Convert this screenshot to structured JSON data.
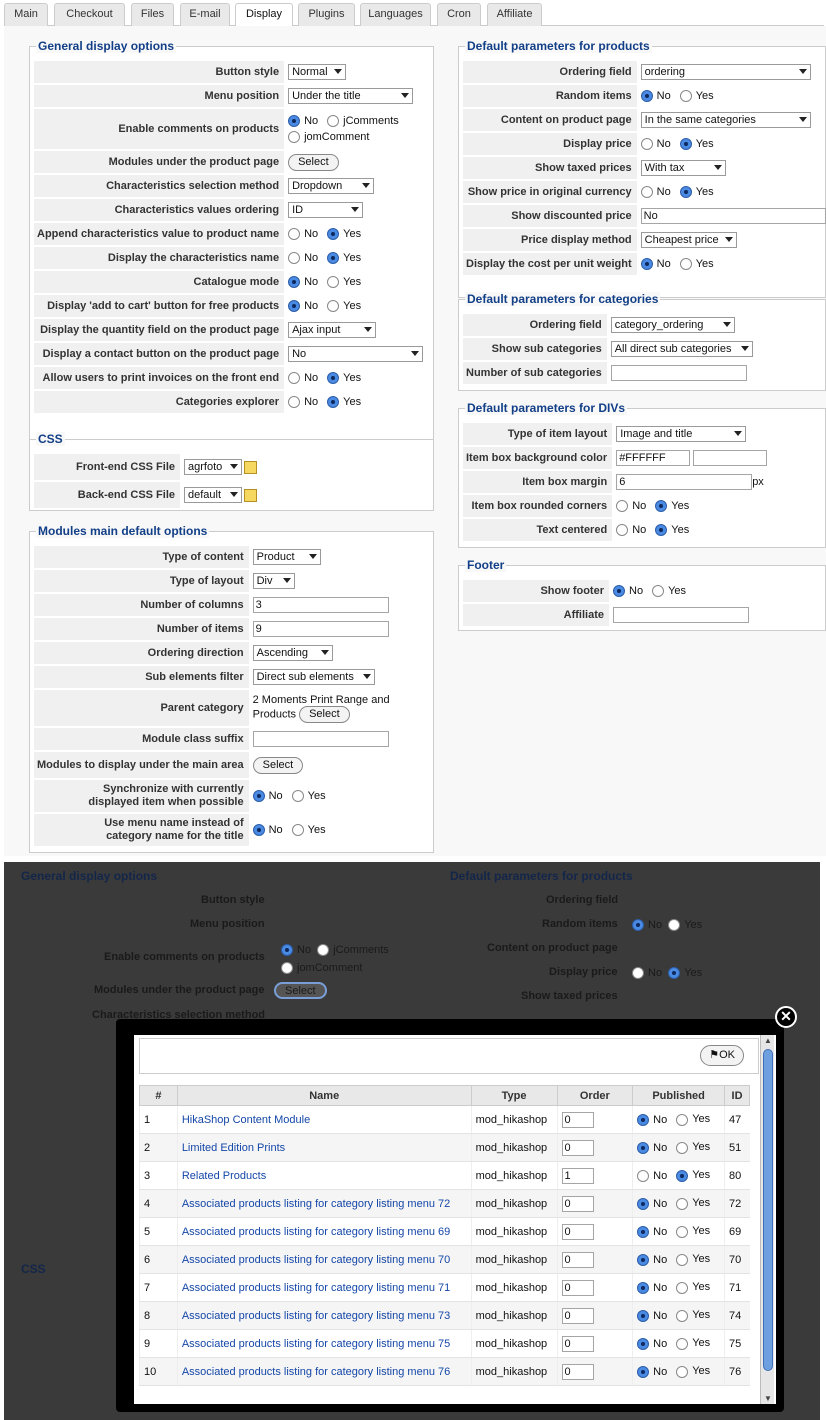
{
  "tabs": [
    {
      "label": "Main"
    },
    {
      "label": "Checkout"
    },
    {
      "label": "Files"
    },
    {
      "label": "E-mail"
    },
    {
      "label": "Display"
    },
    {
      "label": "Plugins"
    },
    {
      "label": "Languages"
    },
    {
      "label": "Cron"
    },
    {
      "label": "Affiliate"
    }
  ],
  "legends": {
    "general": "General display options",
    "css": "CSS",
    "modules": "Modules main default options",
    "products": "Default parameters for products",
    "categories": "Default parameters for categories",
    "divs": "Default parameters for DIVs",
    "footer": "Footer"
  },
  "radio": {
    "no": "No",
    "yes": "Yes",
    "jcomments": "jComments",
    "jomcomment": "jomComment"
  },
  "general": {
    "button_style": {
      "label": "Button style",
      "value": "Normal"
    },
    "menu_position": {
      "label": "Menu position",
      "value": "Under the title"
    },
    "enable_comments": {
      "label": "Enable comments on products"
    },
    "modules_under_product": {
      "label": "Modules under the product page",
      "button": "Select"
    },
    "char_selection": {
      "label": "Characteristics selection method",
      "value": "Dropdown"
    },
    "char_ordering": {
      "label": "Characteristics values ordering",
      "value": "ID"
    },
    "append_char": {
      "label": "Append characteristics value to product name"
    },
    "display_char_name": {
      "label": "Display the characteristics name"
    },
    "catalogue_mode": {
      "label": "Catalogue mode"
    },
    "add_to_cart_free": {
      "label": "Display 'add to cart' button for free products"
    },
    "quantity_field": {
      "label": "Display the quantity field on the product page",
      "value": "Ajax input"
    },
    "contact_button": {
      "label": "Display a contact button on the product page",
      "value": "No"
    },
    "print_invoices": {
      "label": "Allow users to print invoices on the front end"
    },
    "categories_explorer": {
      "label": "Categories explorer"
    }
  },
  "css": {
    "frontend": {
      "label": "Front-end CSS File",
      "value": "agrfoto"
    },
    "backend": {
      "label": "Back-end CSS File",
      "value": "default"
    }
  },
  "modules": {
    "type_content": {
      "label": "Type of content",
      "value": "Product"
    },
    "type_layout": {
      "label": "Type of layout",
      "value": "Div"
    },
    "num_columns": {
      "label": "Number of columns",
      "value": "3"
    },
    "num_items": {
      "label": "Number of items",
      "value": "9"
    },
    "ordering_direction": {
      "label": "Ordering direction",
      "value": "Ascending"
    },
    "sub_elements": {
      "label": "Sub elements filter",
      "value": "Direct sub elements"
    },
    "parent_category": {
      "label": "Parent category",
      "line1": "2 Moments Print Range and",
      "line2": "Products",
      "button": "Select"
    },
    "class_suffix": {
      "label": "Module class suffix",
      "value": ""
    },
    "modules_main": {
      "label": "Modules to display under the main area",
      "button": "Select"
    },
    "sync_l1": "Synchronize with currently",
    "sync_l2": "displayed item when possible",
    "menu_l1": "Use menu name instead of",
    "menu_l2": "category name for the title"
  },
  "products": {
    "ordering_field": {
      "label": "Ordering field",
      "value": "ordering"
    },
    "random_items": {
      "label": "Random items"
    },
    "content_on_page": {
      "label": "Content on product page",
      "value": "In the same categories"
    },
    "display_price": {
      "label": "Display price"
    },
    "show_taxed": {
      "label": "Show taxed prices",
      "value": "With tax"
    },
    "orig_currency": {
      "label": "Show price in original currency"
    },
    "show_discounted": {
      "label": "Show discounted price",
      "value": "No"
    },
    "price_method": {
      "label": "Price display method",
      "value": "Cheapest price"
    },
    "cost_unit_weight": {
      "label": "Display the cost per unit weight"
    }
  },
  "categories": {
    "ordering_field": {
      "label": "Ordering field",
      "value": "category_ordering"
    },
    "show_sub": {
      "label": "Show sub categories",
      "value": "All direct sub categories"
    },
    "num_sub": {
      "label": "Number of sub categories",
      "value": ""
    }
  },
  "divs": {
    "layout": {
      "label": "Type of item layout",
      "value": "Image and title"
    },
    "bg_color": {
      "label": "Item box background color",
      "value": "#FFFFFF"
    },
    "margin": {
      "label": "Item box margin",
      "value": "6",
      "unit": "px"
    },
    "rounded": {
      "label": "Item box rounded corners"
    },
    "centered": {
      "label": "Text centered"
    }
  },
  "footer": {
    "show_footer": {
      "label": "Show footer"
    },
    "affiliate": {
      "label": "Affiliate",
      "value": ""
    }
  },
  "modal": {
    "ok_label": "OK",
    "close_icon": "close-icon",
    "columns": [
      "#",
      "Name",
      "Type",
      "Order",
      "Published",
      "ID"
    ],
    "rows": [
      {
        "num": "1",
        "name": "HikaShop Content Module",
        "type": "mod_hikashop",
        "order": "0",
        "published": false,
        "id": "47"
      },
      {
        "num": "2",
        "name": "Limited Edition Prints",
        "type": "mod_hikashop",
        "order": "0",
        "published": false,
        "id": "51"
      },
      {
        "num": "3",
        "name": "Related Products",
        "type": "mod_hikashop",
        "order": "1",
        "published": true,
        "id": "80"
      },
      {
        "num": "4",
        "name": "Associated products listing for category listing menu 72",
        "type": "mod_hikashop",
        "order": "0",
        "published": false,
        "id": "72"
      },
      {
        "num": "5",
        "name": "Associated products listing for category listing menu 69",
        "type": "mod_hikashop",
        "order": "0",
        "published": false,
        "id": "69"
      },
      {
        "num": "6",
        "name": "Associated products listing for category listing menu 70",
        "type": "mod_hikashop",
        "order": "0",
        "published": false,
        "id": "70"
      },
      {
        "num": "7",
        "name": "Associated products listing for category listing menu 71",
        "type": "mod_hikashop",
        "order": "0",
        "published": false,
        "id": "71"
      },
      {
        "num": "8",
        "name": "Associated products listing for category listing menu 73",
        "type": "mod_hikashop",
        "order": "0",
        "published": false,
        "id": "74"
      },
      {
        "num": "9",
        "name": "Associated products listing for category listing menu 75",
        "type": "mod_hikashop",
        "order": "0",
        "published": false,
        "id": "75"
      },
      {
        "num": "10",
        "name": "Associated products listing for category listing menu 76",
        "type": "mod_hikashop",
        "order": "0",
        "published": false,
        "id": "76"
      }
    ]
  }
}
